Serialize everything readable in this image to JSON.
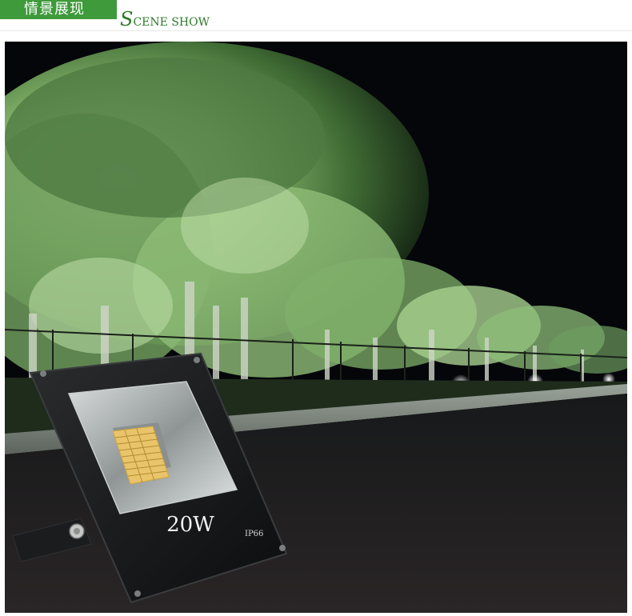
{
  "header": {
    "title_cn": "情景展现",
    "title_en_initial": "S",
    "title_en_rest": "CENE SHOW",
    "accent_color": "#3e9a3a"
  },
  "product": {
    "wattage_label": "20W",
    "rating_label": "IP66"
  },
  "icons": {
    "mounting_bolt": "hex-bolt-icon",
    "corner_screws": "screw-icon"
  }
}
